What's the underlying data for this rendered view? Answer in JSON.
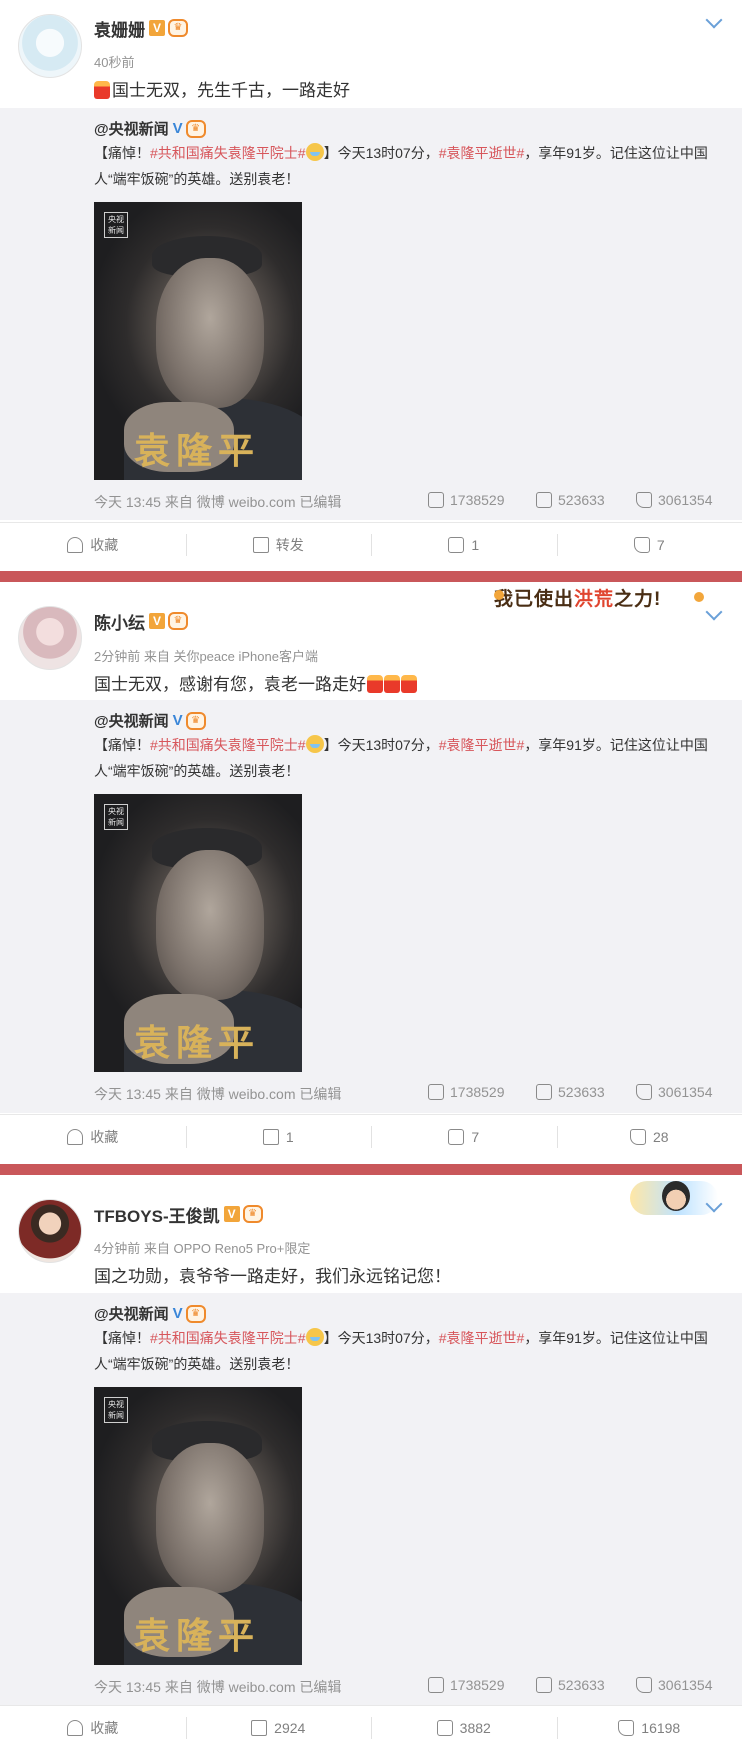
{
  "posts": [
    {
      "author": "袁姗姗",
      "meta": "40秒前",
      "text": "国士无双，先生千古，一路走好",
      "repost": {
        "author": "@央视新闻",
        "text_parts": {
          "prefix": "【痛悼！",
          "tag1": "#共和国痛失袁隆平院士#",
          "mid": "】今天13时07分，",
          "tag2": "#袁隆平逝世#",
          "suffix": "，享年91岁。记住这位让中国人“端牢饭碗”的英雄。送别袁老！"
        },
        "photo_logo": "央视新闻",
        "photo_name": "袁隆平",
        "footer": "今天 13:45 来自 微博 weibo.com   已编辑",
        "reposts": "1738529",
        "comments": "523633",
        "likes": "3061354"
      },
      "actions": {
        "favorite": "收藏",
        "repost": "转发",
        "comment": "1",
        "like": "7"
      }
    },
    {
      "author": "陈小纭",
      "meta": "2分钟前 来自 关你peace iPhone客户端",
      "text": "国士无双，感谢有您，袁老一路走好",
      "decoration": {
        "text_a": "我已使出",
        "text_b": "洪荒",
        "text_c": "之力!"
      },
      "repost": {
        "author": "@央视新闻",
        "text_parts": {
          "prefix": "【痛悼！",
          "tag1": "#共和国痛失袁隆平院士#",
          "mid": "】今天13时07分，",
          "tag2": "#袁隆平逝世#",
          "suffix": "，享年91岁。记住这位让中国人“端牢饭碗”的英雄。送别袁老！"
        },
        "photo_logo": "央视新闻",
        "photo_name": "袁隆平",
        "footer": "今天 13:45 来自 微博 weibo.com   已编辑",
        "reposts": "1738529",
        "comments": "523633",
        "likes": "3061354"
      },
      "actions": {
        "favorite": "收藏",
        "repost": "1",
        "comment": "7",
        "like": "28"
      }
    },
    {
      "author": "TFBOYS-王俊凯",
      "meta": "4分钟前 来自 OPPO Reno5 Pro+限定",
      "text": "国之功勋，袁爷爷一路走好，我们永远铭记您！",
      "repost": {
        "author": "@央视新闻",
        "text_parts": {
          "prefix": "【痛悼！",
          "tag1": "#共和国痛失袁隆平院士#",
          "mid": "】今天13时07分，",
          "tag2": "#袁隆平逝世#",
          "suffix": "，享年91岁。记住这位让中国人“端牢饭碗”的英雄。送别袁老！"
        },
        "photo_logo": "央视新闻",
        "photo_name": "袁隆平",
        "footer": "今天 13:45 来自 微博 weibo.com   已编辑",
        "reposts": "1738529",
        "comments": "523633",
        "likes": "3061354"
      },
      "actions": {
        "favorite": "收藏",
        "repost": "2924",
        "comment": "3882",
        "like": "16198"
      }
    }
  ],
  "badges": {
    "vip": "V",
    "crown": "👑"
  },
  "colors": {
    "divider": "#c9575a",
    "tag": "#d7565b",
    "repost_bg": "#f2f2f5",
    "verified_blue": "#3a86d8"
  },
  "icons": [
    "chevron-down-icon",
    "candle-icon",
    "cry-emoji-icon",
    "repost-icon",
    "comment-icon",
    "like-icon",
    "favorite-icon"
  ]
}
